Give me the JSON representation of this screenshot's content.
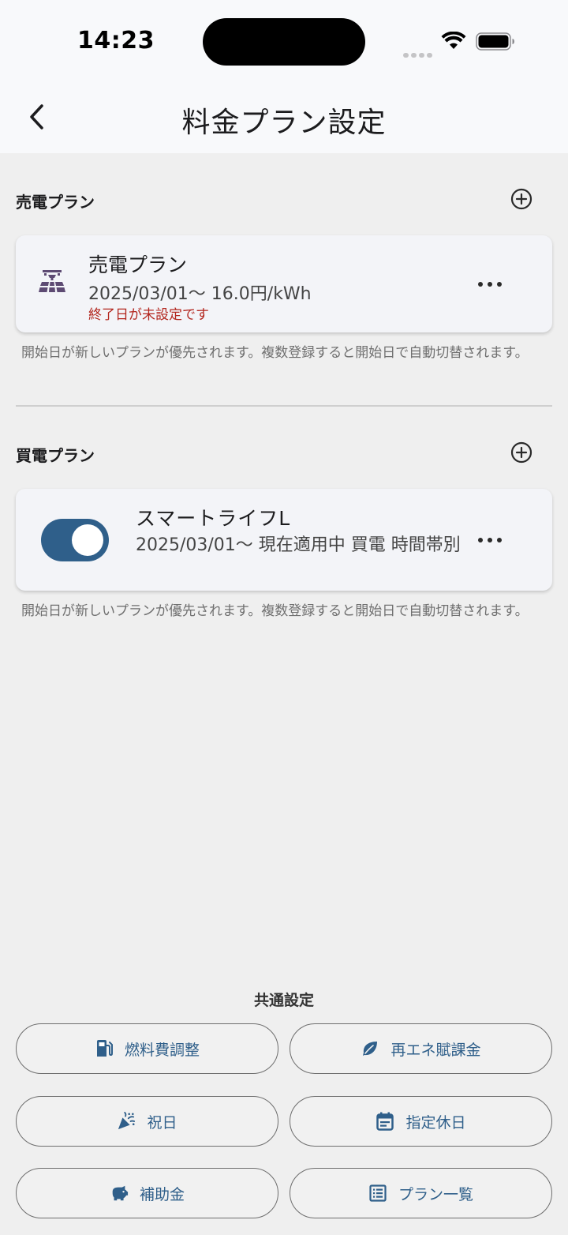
{
  "status_bar": {
    "time": "14:23"
  },
  "header": {
    "title": "料金プラン設定"
  },
  "sell_section": {
    "title": "売電プラン",
    "card": {
      "name": "売電プラン",
      "detail": "2025/03/01〜  16.0円/kWh",
      "warning": "終了日が未設定です",
      "icon": "solar-panel-icon"
    },
    "hint": "開始日が新しいプランが優先されます。複数登録すると開始日で自動切替されます。"
  },
  "buy_section": {
    "title": "買電プラン",
    "card": {
      "name": "スマートライフL",
      "detail": "2025/03/01〜 現在適用中  買電 時間帯別",
      "enabled": true
    },
    "hint": "開始日が新しいプランが優先されます。複数登録すると開始日で自動切替されます。"
  },
  "common": {
    "title": "共通設定",
    "buttons": [
      {
        "label": "燃料費調整",
        "icon": "fuel-pump-icon"
      },
      {
        "label": "再エネ賦課金",
        "icon": "leaf-icon"
      },
      {
        "label": "祝日",
        "icon": "party-popper-icon"
      },
      {
        "label": "指定休日",
        "icon": "calendar-icon"
      },
      {
        "label": "補助金",
        "icon": "piggy-bank-icon"
      },
      {
        "label": "プラン一覧",
        "icon": "list-icon"
      }
    ]
  },
  "colors": {
    "accent": "#2f5f8a",
    "warning": "#b3261e",
    "background": "#efefef",
    "card": "#f3f4f8"
  }
}
